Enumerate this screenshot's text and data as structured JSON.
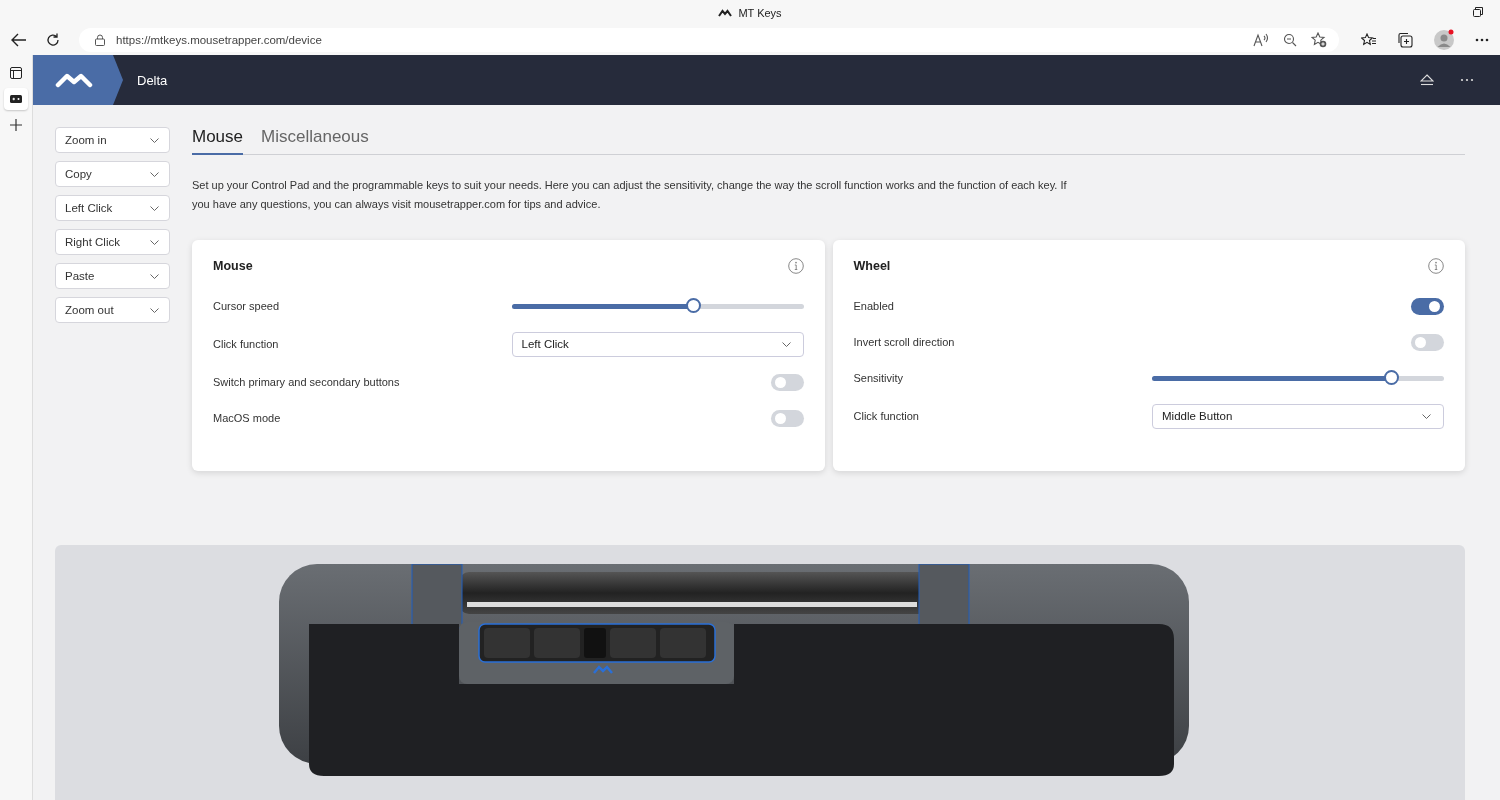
{
  "browser": {
    "title": "MT Keys",
    "url": "https://mtkeys.mousetrapper.com/device"
  },
  "app": {
    "device_name": "Delta"
  },
  "key_dropdowns": [
    {
      "value": "Zoom in"
    },
    {
      "value": "Copy"
    },
    {
      "value": "Left Click"
    },
    {
      "value": "Right Click"
    },
    {
      "value": "Paste"
    },
    {
      "value": "Zoom out"
    }
  ],
  "tabs": [
    {
      "label": "Mouse",
      "selected": true
    },
    {
      "label": "Miscellaneous",
      "selected": false
    }
  ],
  "intro": "Set up your Control Pad and the programmable keys to suit your needs. Here you can adjust the sensitivity, change the way the scroll function works and the function of each key. If you have any questions, you can always visit mousetrapper.com for tips and advice.",
  "panels": [
    {
      "title": "Mouse",
      "rows": [
        {
          "kind": "slider",
          "label": "Cursor speed",
          "level": 0.62
        },
        {
          "kind": "select",
          "label": "Click function",
          "value": "Left Click"
        },
        {
          "kind": "toggle",
          "label": "Switch primary and secondary buttons",
          "on": false
        },
        {
          "kind": "toggle",
          "label": "MacOS mode",
          "on": false
        }
      ]
    },
    {
      "title": "Wheel",
      "rows": [
        {
          "kind": "toggle",
          "label": "Enabled",
          "on": true
        },
        {
          "kind": "toggle",
          "label": "Invert scroll direction",
          "on": false
        },
        {
          "kind": "slider",
          "label": "Sensitivity",
          "level": 0.82
        },
        {
          "kind": "select",
          "label": "Click function",
          "value": "Middle Button"
        }
      ]
    }
  ]
}
